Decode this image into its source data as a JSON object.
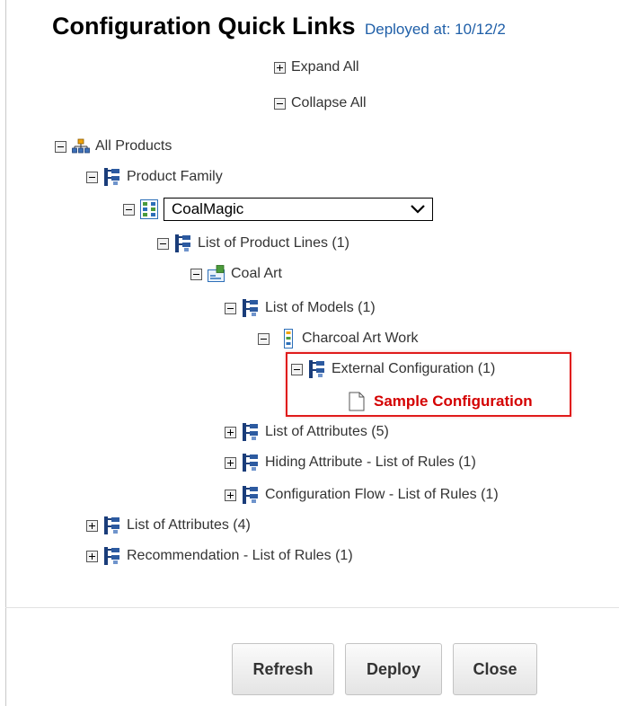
{
  "header": {
    "title": "Configuration Quick Links",
    "deployed": "Deployed at: 10/12/2"
  },
  "actions": {
    "expand_all": "Expand All",
    "collapse_all": "Collapse All"
  },
  "tree": {
    "all_products": "All Products",
    "product_family": "Product Family",
    "family_select_value": "CoalMagic",
    "product_lines": "List of Product Lines (1)",
    "coal_art": "Coal Art",
    "models": "List of Models (1)",
    "charcoal": "Charcoal Art Work",
    "external_config": "External Configuration (1)",
    "sample_config": "Sample Configuration",
    "attributes_5": "List of Attributes (5)",
    "hiding": "Hiding Attribute - List of Rules (1)",
    "config_flow": "Configuration Flow - List of Rules (1)",
    "attributes_4": "List of Attributes (4)",
    "recommendation": "Recommendation - List of Rules (1)"
  },
  "buttons": {
    "refresh": "Refresh",
    "deploy": "Deploy",
    "close": "Close"
  },
  "colors": {
    "highlight": "#e01b1b",
    "sample_text": "#d40000",
    "deployed_text": "#1f5fa8"
  },
  "icons": {
    "list": "list-tree-icon",
    "root": "hierarchy-icon",
    "family": "grid-icon",
    "line": "product-line-icon",
    "model": "model-icon",
    "doc": "document-icon"
  }
}
